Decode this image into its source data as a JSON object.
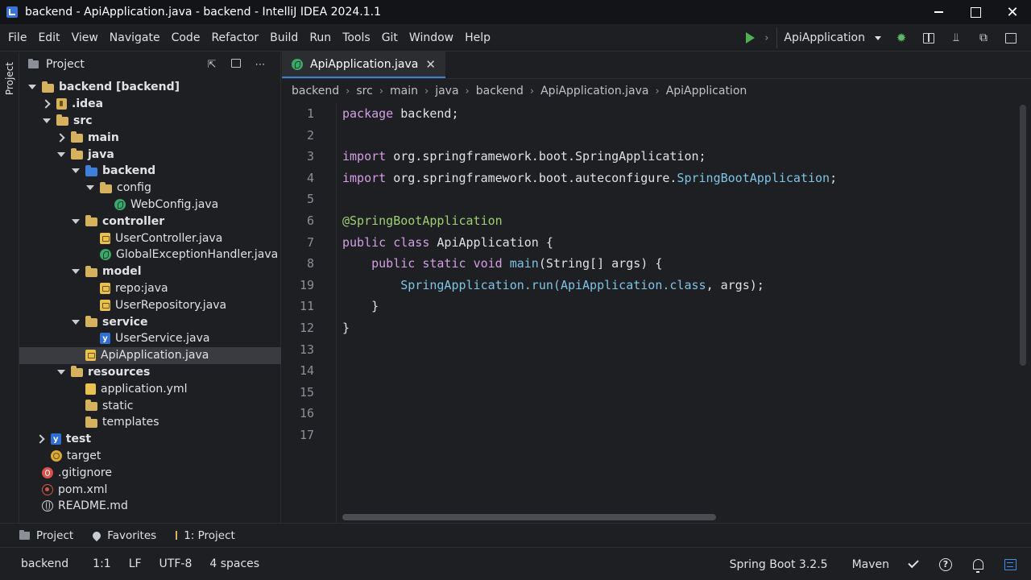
{
  "window": {
    "title": "backend - ApiApplication.java - backend - IntelliJ IDEA 2024.1.1"
  },
  "menu": [
    "File",
    "Edit",
    "View",
    "Navigate",
    "Code",
    "Refactor",
    "Build",
    "Run",
    "Tools",
    "Git",
    "Window",
    "Help"
  ],
  "toolbar": {
    "run_config": "ApiApplication"
  },
  "left_stripe": {
    "label": "Project"
  },
  "project_panel": {
    "title": "Project",
    "tree": [
      {
        "label": "backend [backend]",
        "depth": 0,
        "arrow": "open",
        "icon": "folder-icon",
        "bold": true
      },
      {
        "label": ".idea",
        "depth": 1,
        "arrow": "closed",
        "icon": "idea-folder-icon",
        "bold": true
      },
      {
        "label": "src",
        "depth": 1,
        "arrow": "open",
        "icon": "folder-icon",
        "bold": true
      },
      {
        "label": "main",
        "depth": 2,
        "arrow": "closed",
        "icon": "folder-icon",
        "bold": true
      },
      {
        "label": "java",
        "depth": 2,
        "arrow": "open",
        "icon": "folder-icon",
        "bold": true
      },
      {
        "label": "backend",
        "depth": 3,
        "arrow": "open",
        "icon": "package-folder-icon",
        "bold": true
      },
      {
        "label": "config",
        "depth": 4,
        "arrow": "open",
        "icon": "folder-icon",
        "bold": false
      },
      {
        "label": "WebConfig.java",
        "depth": 5,
        "arrow": "none",
        "icon": "spring-file-icon",
        "bold": false
      },
      {
        "label": "controller",
        "depth": 3,
        "arrow": "open",
        "icon": "folder-icon",
        "bold": true
      },
      {
        "label": "UserController.java",
        "depth": 4,
        "arrow": "none",
        "icon": "java-file-icon",
        "bold": false
      },
      {
        "label": "GlobalExceptionHandler.java",
        "depth": 4,
        "arrow": "none",
        "icon": "spring-file-icon",
        "bold": false
      },
      {
        "label": "model",
        "depth": 3,
        "arrow": "open",
        "icon": "folder-icon",
        "bold": true
      },
      {
        "label": "repo:java",
        "depth": 4,
        "arrow": "none",
        "icon": "java-file-icon",
        "bold": false
      },
      {
        "label": "UserRepository.java",
        "depth": 4,
        "arrow": "none",
        "icon": "java-file-icon",
        "bold": false
      },
      {
        "label": "service",
        "depth": 3,
        "arrow": "open",
        "icon": "folder-icon",
        "bold": true
      },
      {
        "label": "UserService.java",
        "depth": 4,
        "arrow": "none",
        "icon": "kotlin-file-icon",
        "bold": false
      },
      {
        "label": "ApiApplication.java",
        "depth": 3,
        "arrow": "none",
        "icon": "java-file-icon",
        "bold": false,
        "selected": true
      },
      {
        "label": "resources",
        "depth": 2,
        "arrow": "open",
        "icon": "folder-icon",
        "bold": true
      },
      {
        "label": "application.yml",
        "depth": 3,
        "arrow": "none",
        "icon": "yaml-file-icon",
        "bold": false
      },
      {
        "label": "static",
        "depth": 3,
        "arrow": "none",
        "icon": "folder-icon",
        "bold": false
      },
      {
        "label": "templates",
        "depth": 3,
        "arrow": "none",
        "icon": "folder-icon",
        "bold": false
      },
      {
        "label": "test",
        "depth": 0.6,
        "arrow": "closed",
        "icon": "test-folder-icon",
        "bold": true
      },
      {
        "label": "target",
        "depth": 0.6,
        "arrow": "none",
        "icon": "target-folder-icon",
        "bold": false
      },
      {
        "label": ".gitignore",
        "depth": 0,
        "arrow": "none",
        "icon": "git-file-icon",
        "bold": false
      },
      {
        "label": "pom.xml",
        "depth": 0,
        "arrow": "none",
        "icon": "maven-file-icon",
        "bold": false
      },
      {
        "label": "README.md",
        "depth": 0,
        "arrow": "none",
        "icon": "globe-icon",
        "bold": false
      }
    ]
  },
  "editor": {
    "tab": {
      "label": "ApiApplication.java"
    },
    "breadcrumbs": [
      "backend",
      "src",
      "main",
      "java",
      "backend",
      "ApiApplication.java",
      "ApiApplication"
    ],
    "line_numbers": [
      "1",
      "2",
      "3",
      "4",
      "5",
      "6",
      "7",
      "8",
      "19",
      "11",
      "12",
      "13",
      "14",
      "15",
      "16",
      "17"
    ],
    "code_lines": [
      [
        {
          "t": "package",
          "c": "kw"
        },
        {
          "t": " backend;",
          "c": "pl"
        }
      ],
      [],
      [
        {
          "t": "import",
          "c": "kw"
        },
        {
          "t": " org.springframework.boot.SpringApplication;",
          "c": "pl"
        }
      ],
      [
        {
          "t": "import",
          "c": "kw"
        },
        {
          "t": " org.springframework.boot.auteconfigure.",
          "c": "pl"
        },
        {
          "t": "SpringBootApplication",
          "c": "ty"
        },
        {
          "t": ";",
          "c": "pl"
        }
      ],
      [],
      [
        {
          "t": "@SpringBootApplication",
          "c": "an"
        }
      ],
      [
        {
          "t": "public",
          "c": "kw"
        },
        {
          "t": " ",
          "c": "pl"
        },
        {
          "t": "class",
          "c": "kw"
        },
        {
          "t": " ApiApplication {",
          "c": "pl"
        }
      ],
      [
        {
          "t": "    ",
          "c": "pl"
        },
        {
          "t": "public",
          "c": "kw"
        },
        {
          "t": " ",
          "c": "pl"
        },
        {
          "t": "static",
          "c": "kw"
        },
        {
          "t": " ",
          "c": "pl"
        },
        {
          "t": "void",
          "c": "kw"
        },
        {
          "t": " ",
          "c": "pl"
        },
        {
          "t": "main",
          "c": "ty"
        },
        {
          "t": "(String[] args) {",
          "c": "pl"
        }
      ],
      [
        {
          "t": "        ",
          "c": "pl"
        },
        {
          "t": "SpringApplication.run(",
          "c": "ty"
        },
        {
          "t": "ApiApplication.class",
          "c": "ty"
        },
        {
          "t": ", args);",
          "c": "pl"
        }
      ],
      [
        {
          "t": "    }",
          "c": "pl"
        }
      ],
      [
        {
          "t": "}",
          "c": "pl"
        }
      ],
      [],
      [],
      [],
      [],
      []
    ]
  },
  "bottom_tabs": [
    "Project",
    "Favorites",
    "1: Project"
  ],
  "status": {
    "project": "backend",
    "position": "1:1",
    "line_sep": "LF",
    "encoding": "UTF-8",
    "indent": "4 spaces",
    "framework": "Spring Boot 3.2.5",
    "build_tool": "Maven"
  },
  "colors": {
    "keyword": "#d49ee6",
    "annotation": "#9fcf73",
    "type": "#7ec3e8",
    "accent": "#3d7fd9"
  }
}
